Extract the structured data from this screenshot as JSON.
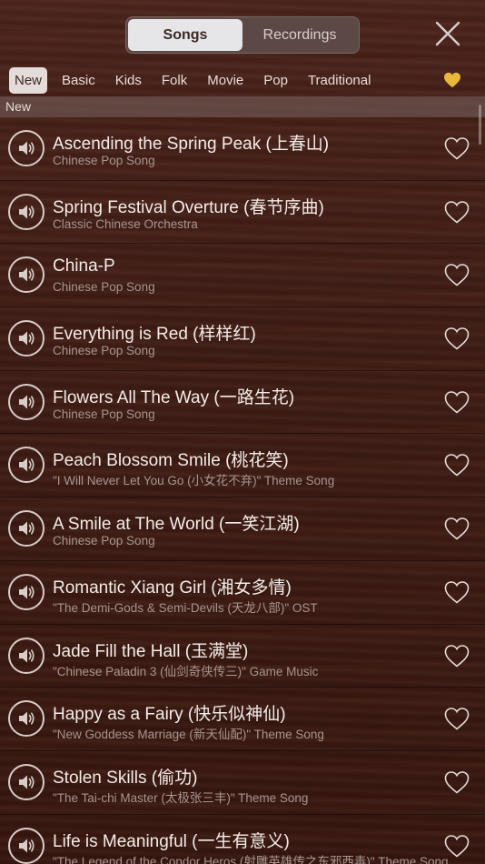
{
  "segments": [
    {
      "label": "Songs",
      "active": true
    },
    {
      "label": "Recordings",
      "active": false
    }
  ],
  "close_icon": "close-icon",
  "categories": [
    {
      "label": "New",
      "active": true
    },
    {
      "label": "Basic",
      "active": false
    },
    {
      "label": "Kids",
      "active": false
    },
    {
      "label": "Folk",
      "active": false
    },
    {
      "label": "Movie",
      "active": false
    },
    {
      "label": "Pop",
      "active": false
    },
    {
      "label": "Traditional",
      "active": false
    }
  ],
  "favorites_icon": "heart-filled-icon",
  "favorites_color": "#e8b83a",
  "section_title": "New",
  "songs": [
    {
      "title": "Ascending the Spring Peak (上春山)",
      "subtitle": "Chinese Pop Song"
    },
    {
      "title": "Spring Festival Overture (春节序曲)",
      "subtitle": "Classic Chinese Orchestra"
    },
    {
      "title": "China-P",
      "subtitle": "Chinese Pop Song"
    },
    {
      "title": "Everything is Red (样样红)",
      "subtitle": "Chinese Pop Song"
    },
    {
      "title": "Flowers All The Way (一路生花)",
      "subtitle": "Chinese Pop Song"
    },
    {
      "title": "Peach Blossom Smile (桃花笑)",
      "subtitle": "\"I Will Never Let You Go (小女花不弃)\" Theme Song"
    },
    {
      "title": "A Smile at The World (一笑江湖)",
      "subtitle": "Chinese Pop Song"
    },
    {
      "title": "Romantic Xiang Girl (湘女多情)",
      "subtitle": "\"The Demi-Gods & Semi-Devils (天龙八部)\" OST"
    },
    {
      "title": "Jade Fill the Hall (玉满堂)",
      "subtitle": "\"Chinese Paladin 3 (仙剑奇侠传三)\" Game Music"
    },
    {
      "title": "Happy as a Fairy (快乐似神仙)",
      "subtitle": "\"New Goddess Marriage (新天仙配)\" Theme Song"
    },
    {
      "title": "Stolen Skills (偷功)",
      "subtitle": "\"The Tai-chi Master (太极张三丰)\" Theme Song"
    },
    {
      "title": "Life is Meaningful (一生有意义)",
      "subtitle": "\"The Legend of the Condor Heros (射雕英雄传之东邪西毒)\" Theme Song"
    }
  ]
}
